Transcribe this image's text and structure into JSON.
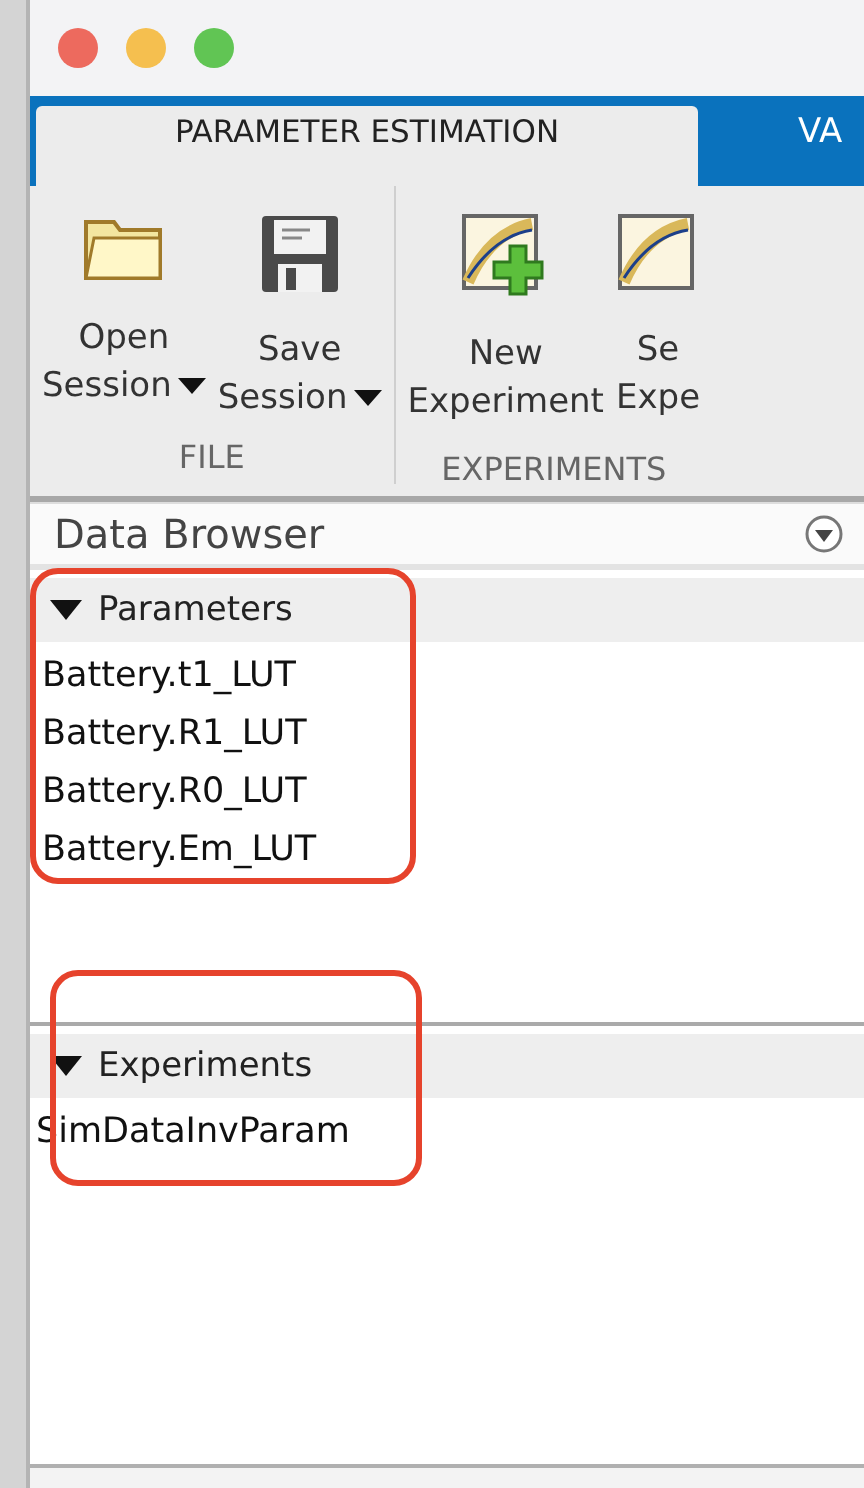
{
  "window": {
    "controls": [
      {
        "kind": "close"
      },
      {
        "kind": "minimize"
      },
      {
        "kind": "zoom"
      }
    ]
  },
  "tabs": [
    {
      "label": "PARAMETER ESTIMATION",
      "selected": true
    },
    {
      "label": "VA",
      "selected": false
    }
  ],
  "toolbar": [
    {
      "label": "FILE",
      "buttons": [
        {
          "lines": [
            "Open",
            "Session"
          ],
          "dropdown": true
        },
        {
          "lines": [
            "Save",
            "Session"
          ],
          "dropdown": true
        }
      ]
    },
    {
      "label": "EXPERIMENTS",
      "buttons": [
        {
          "lines": [
            "New",
            "Experiment"
          ],
          "dropdown": false
        },
        {
          "lines": [
            "Se",
            "Expe"
          ],
          "dropdown": false
        }
      ]
    }
  ],
  "data_browser": {
    "title": "Data Browser",
    "sections": [
      {
        "title": "Parameters",
        "expanded": true,
        "highlighted": true,
        "items": [
          "Battery.t1_LUT",
          "Battery.R1_LUT",
          "Battery.R0_LUT",
          "Battery.Em_LUT"
        ]
      },
      {
        "title": "Experiments",
        "expanded": true,
        "highlighted": true,
        "items": [
          "SimDataInvParam"
        ]
      }
    ]
  }
}
